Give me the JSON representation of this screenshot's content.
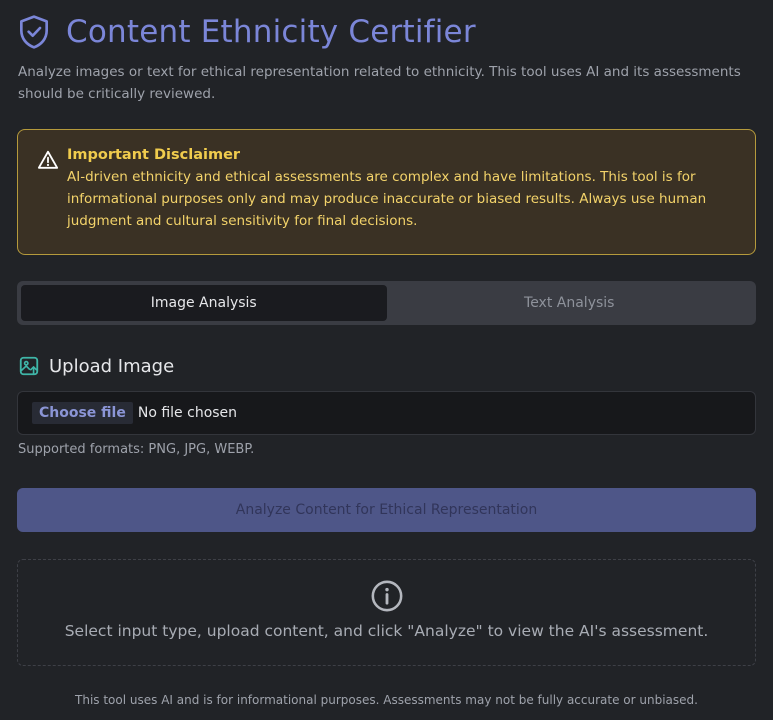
{
  "app": {
    "title": "Content Ethnicity Certifier",
    "subtitle": "Analyze images or text for ethical representation related to ethnicity. This tool uses AI and its assessments should be critically reviewed.",
    "logo_icon": "shield-check-icon"
  },
  "disclaimer": {
    "icon": "warning-triangle-icon",
    "title": "Important Disclaimer",
    "body": "AI-driven ethnicity and ethical assessments are complex and have limitations. This tool is for informational purposes only and may produce inaccurate or biased results. Always use human judgment and cultural sensitivity for final decisions."
  },
  "tabs": [
    {
      "label": "Image Analysis",
      "active": true
    },
    {
      "label": "Text Analysis",
      "active": false
    }
  ],
  "upload": {
    "icon": "image-upload-icon",
    "heading": "Upload Image",
    "choose_label": "Choose file",
    "file_status": "No file chosen",
    "formats": "Supported formats: PNG, JPG, WEBP."
  },
  "analyze_button": "Analyze Content for Ethical Representation",
  "result": {
    "icon": "info-icon",
    "message": "Select input type, upload content, and click \"Analyze\" to view the AI's assessment."
  },
  "footer": "This tool uses AI and is for informational purposes. Assessments may not be fully accurate or unbiased.",
  "colors": {
    "background": "#212327",
    "accent": "#7b86d8",
    "warning_border": "#b59a3c",
    "warning_text": "#f3d36a",
    "upload_icon": "#3fb6a8"
  }
}
